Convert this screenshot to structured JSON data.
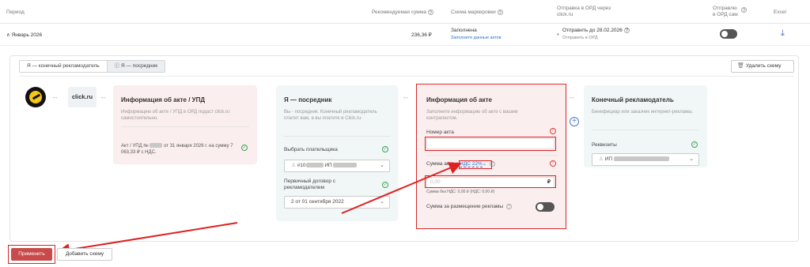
{
  "header": {
    "period": "Период",
    "recommended_sum": "Рекомендуемая сумма",
    "marking_scheme": "Схема маркировки",
    "send_to_ord": "Отправка в ОРД через click.ru",
    "sent_by_self": "Отправлю в ОРД сам",
    "excel": "Excel"
  },
  "row": {
    "period": "Январь 2026",
    "sum": "236,36 ₽",
    "scheme_status": "Заполнена",
    "scheme_link": "Заполните данные актов",
    "send_deadline": "Отправить до 28.02.2026",
    "send_link": "Отправить в ОРД"
  },
  "tabs": [
    "Я — конечный рекламодатель",
    "Я — посредник"
  ],
  "delete_scheme": "Удалить схему",
  "logo_text": "click.ru",
  "card_act": {
    "title": "Информация об акте / УПД",
    "desc": "Информацию об акте / УПД в ОРД подаст click.ru самостоятельно.",
    "act_prefix": "Акт / УПД №",
    "act_suffix": "от 31 января 2026 г. на сумму 7 063,33 ₽ с НДС."
  },
  "card_mid": {
    "title": "Я — посредник",
    "desc": "Вы - посредник. Конечный рекламодатель платит вам, а вы платите в Click.ru.",
    "payer_label": "Выбрать плательщика",
    "payer_value": "#10",
    "payer_ip": "ИП",
    "contract_label": "Первичный договор с рекламодателем",
    "contract_value": "2 от 01 сентября 2022"
  },
  "card_info": {
    "title": "Информация об акте",
    "desc": "Заполните информацию об акте с вашим контрагентом.",
    "act_number_label": "Номер акта",
    "act_number_value": "",
    "sum_label": "Сумма акта",
    "vat_option": "с НДС 22%",
    "sum_placeholder": "0,00",
    "currency": "₽",
    "sum_note": "Сумма без НДС: 0,00 ₽ (НДС: 0,00 ₽)",
    "ad_sum_label": "Сумма за размещение рекламы"
  },
  "card_end": {
    "title": "Конечный рекламодатель",
    "desc": "Бенефициар или заказчик интернет-рекламы.",
    "req_label": "Реквизиты",
    "req_value": "ИП"
  },
  "apply_button": "Применить",
  "add_scheme_button": "Добавить схему",
  "colors": {
    "accent_red": "#e02020",
    "apply_bg": "#c94a4a",
    "ok_green": "#3aa655",
    "link_blue": "#2b6fd6"
  }
}
